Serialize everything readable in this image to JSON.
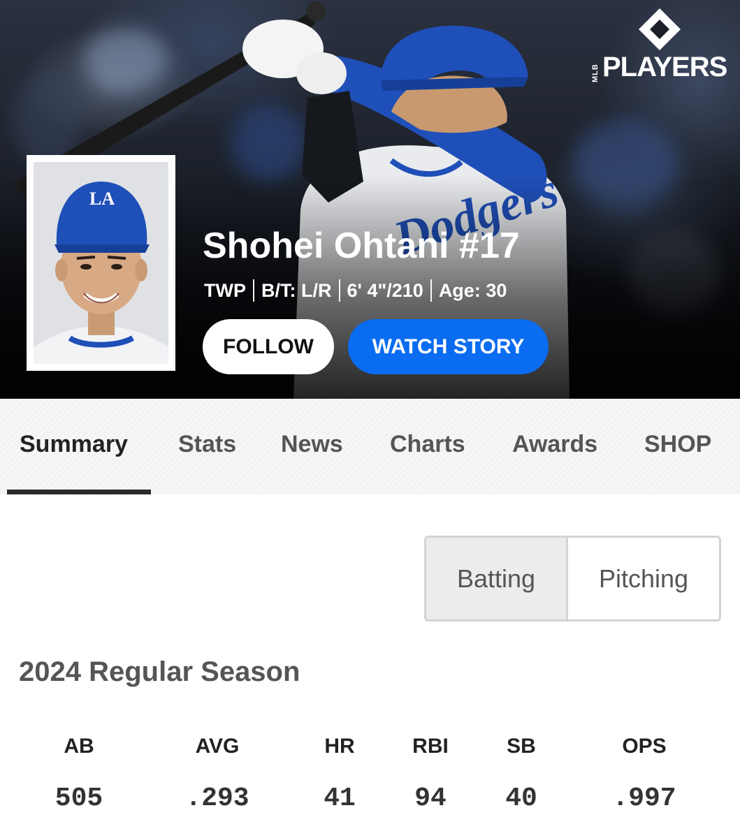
{
  "brand": {
    "logo_mlb": "MLB",
    "logo_text": "PLAYERS"
  },
  "player": {
    "name": "Shohei Ohtani #17",
    "position": "TWP",
    "bats_throws": "B/T: L/R",
    "height_weight": "6' 4\"/210",
    "age": "Age: 30",
    "team_cap_letters": "LA"
  },
  "actions": {
    "follow_label": "FOLLOW",
    "watch_label": "WATCH STORY"
  },
  "tabs": [
    {
      "label": "Summary",
      "active": true
    },
    {
      "label": "Stats"
    },
    {
      "label": "News"
    },
    {
      "label": "Charts"
    },
    {
      "label": "Awards"
    },
    {
      "label": "SHOP"
    }
  ],
  "toggle": {
    "batting": "Batting",
    "pitching": "Pitching",
    "selected": "Batting"
  },
  "season": {
    "title": "2024 Regular Season",
    "stats": [
      {
        "label": "AB",
        "value": "505"
      },
      {
        "label": "AVG",
        "value": ".293"
      },
      {
        "label": "HR",
        "value": "41"
      },
      {
        "label": "RBI",
        "value": "94"
      },
      {
        "label": "SB",
        "value": "40"
      },
      {
        "label": "OPS",
        "value": ".997"
      }
    ]
  },
  "colors": {
    "accent": "#0a6cf0",
    "team_blue": "#1f4fb8",
    "text_dark": "#222222",
    "text_muted": "#555555"
  }
}
